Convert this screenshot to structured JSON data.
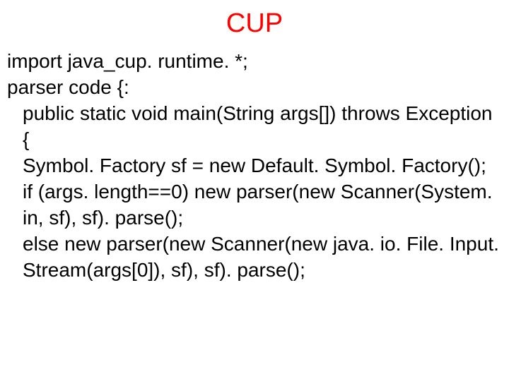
{
  "title": "CUP",
  "code": {
    "line1": "import java_cup. runtime. *;",
    "line2": "parser code {:",
    "line3": "public static void main(String args[]) throws Exception {",
    "line4": " Symbol. Factory sf = new Default. Symbol. Factory();",
    "line5": " if (args. length==0) new parser(new Scanner(System. in, sf), sf). parse();",
    "line6": " else new parser(new Scanner(new java. io. File. Input. Stream(args[0]), sf), sf). parse();"
  }
}
